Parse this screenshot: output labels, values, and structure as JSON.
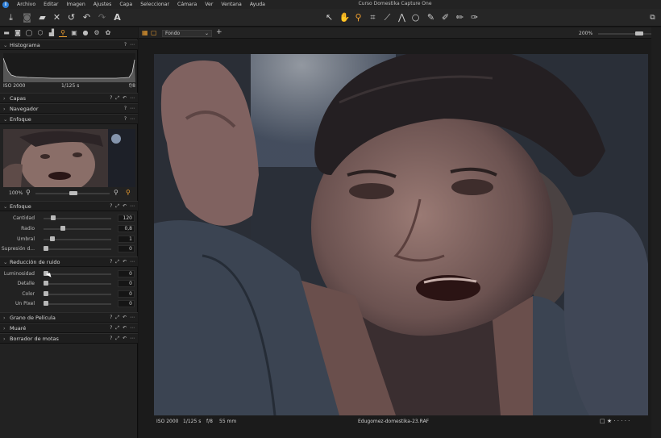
{
  "app": {
    "title": "Curso Domestika Capture One",
    "logo": "i",
    "colors": {
      "accent": "#f0a030",
      "panel": "#222222",
      "header": "#1e1e1e"
    }
  },
  "menu": [
    "Archivo",
    "Editar",
    "Imagen",
    "Ajustes",
    "Capa",
    "Seleccionar",
    "Cámara",
    "Ver",
    "Ventana",
    "Ayuda"
  ],
  "toolbar": {
    "left_icons": [
      "import-icon",
      "camera-icon",
      "folder-icon",
      "delete-icon",
      "undo-all-icon",
      "undo-icon",
      "redo-icon",
      "text-icon"
    ],
    "cursor_tools": [
      "select-icon",
      "pan-icon",
      "loupe-icon",
      "crop-icon",
      "straighten-icon",
      "keystone-icon",
      "spot-icon",
      "brush-icon",
      "gradient-icon",
      "eraser-icon",
      "picker-icon"
    ],
    "right_icon": "compare-icon"
  },
  "tool_tabs": [
    "library-icon",
    "capture-icon",
    "lens-icon",
    "color-icon",
    "exposure-icon",
    "details-icon",
    "metadata-icon",
    "adjust-icon",
    "output-icon",
    "batch-icon",
    "styles-icon"
  ],
  "panel": {
    "histogram": {
      "title": "Histograma",
      "iso": "ISO 2000",
      "shutter": "1/125 s",
      "aperture": "f/8"
    },
    "layers": {
      "title": "Capas"
    },
    "navigator": {
      "title": "Navegador"
    },
    "focus_viewer": {
      "title": "Enfoque",
      "zoom": "100%"
    },
    "sharpening": {
      "title": "Enfoque",
      "sliders": [
        {
          "label": "Cantidad",
          "value": "120",
          "level": 0.12
        },
        {
          "label": "Radio",
          "value": "0,8",
          "level": 0.27
        },
        {
          "label": "Umbral",
          "value": "1",
          "level": 0.1
        },
        {
          "label": "Supresión d...",
          "value": "0",
          "level": 0.0
        }
      ]
    },
    "noise": {
      "title": "Reducción de ruido",
      "sliders": [
        {
          "label": "Luminosidad",
          "value": "0",
          "level": 0.0
        },
        {
          "label": "Detalle",
          "value": "0",
          "level": 0.0
        },
        {
          "label": "Color",
          "value": "0",
          "level": 0.0
        },
        {
          "label": "Un Pixel",
          "value": "0",
          "level": 0.0
        }
      ]
    },
    "grain": {
      "title": "Grano de Película"
    },
    "moire": {
      "title": "Muaré"
    },
    "spots": {
      "title": "Borrador de motas"
    },
    "section_controls": "? ⤢ ↶ ⋯"
  },
  "viewer": {
    "layer_select": "Fondo",
    "zoom": "200%",
    "info": {
      "iso": "ISO 2000",
      "shutter": "1/125 s",
      "aperture": "f/8",
      "focal": "55 mm"
    },
    "filename": "Edugomez-domestika-23.RAF"
  }
}
